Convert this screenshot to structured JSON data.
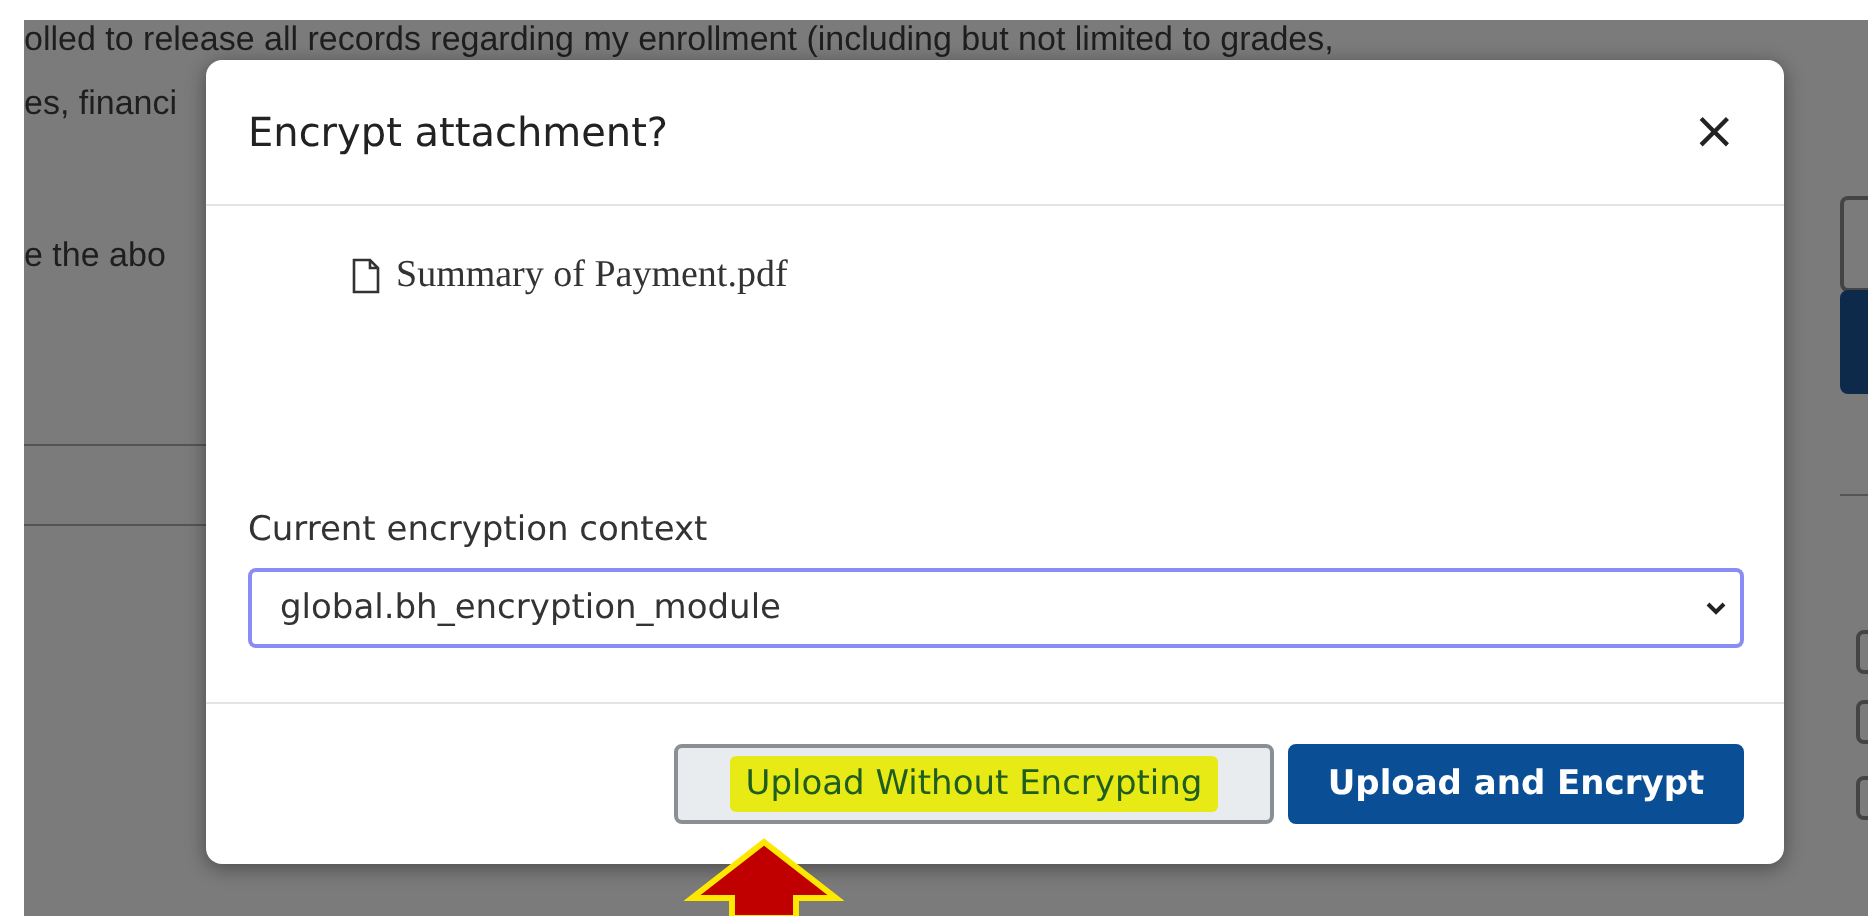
{
  "background": {
    "lines": [
      "olled to release all records regarding my enrollment (including but not limited to grades,",
      "es, financi",
      "e the abo"
    ]
  },
  "dialog": {
    "title": "Encrypt attachment?",
    "close": "×",
    "file": "Summary of Payment.pdf",
    "field": {
      "label": "Current encryption context",
      "value": "global.bh_encryption_module"
    },
    "buttons": [
      {
        "label": "Upload Without Encrypting",
        "kind": "secondary",
        "highlighted": true
      },
      {
        "label": "Upload and Encrypt",
        "kind": "primary",
        "highlighted": false
      }
    ]
  }
}
